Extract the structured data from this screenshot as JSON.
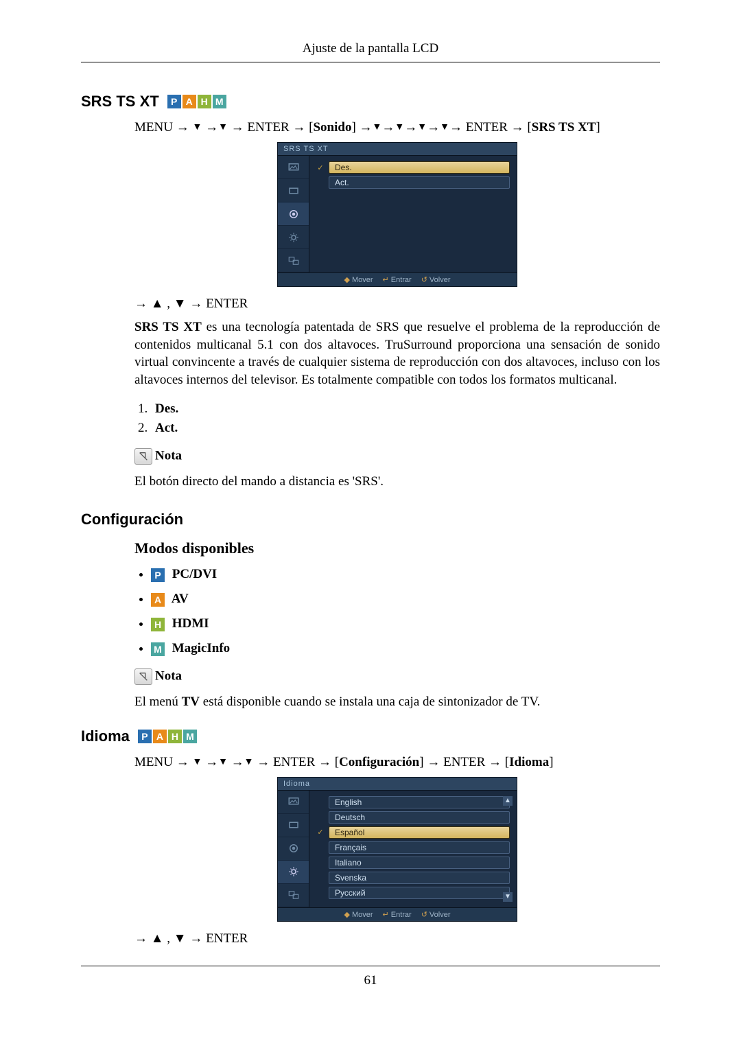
{
  "page": {
    "header": "Ajuste de la pantalla LCD",
    "number": "61"
  },
  "badges": {
    "p": "P",
    "a": "A",
    "h": "H",
    "m": "M"
  },
  "srs": {
    "title": "SRS TS XT",
    "path_pre": "MENU → ",
    "path_enter1": " → ENTER → [",
    "path_sonido": "Sonido",
    "path_mid": "] →",
    "path_enter2": "→ ENTER → [",
    "path_final": "SRS TS XT",
    "path_close": "]",
    "nav_after": "→ ▲ , ▼ → ENTER",
    "desc": "SRS TS XT es una tecnología patentada de SRS que resuelve el problema de la reproducción de contenidos multicanal 5.1 con dos altavoces. TruSurround proporciona una sensación de sonido virtual convincente a través de cualquier sistema de reproducción con dos altavoces, incluso con los altavoces internos del televisor. Es totalmente compatible con todos los formatos multicanal.",
    "opt1": "Des.",
    "opt2": "Act.",
    "nota_label": "Nota",
    "nota_text": "El botón directo del mando a distancia es 'SRS'.",
    "osd": {
      "title": "SRS TS XT",
      "row_selected": "Des.",
      "row_other": "Act.",
      "footer_move": "Mover",
      "footer_enter": "Entrar",
      "footer_back": "Volver"
    }
  },
  "config": {
    "title": "Configuración",
    "modes_title": "Modos disponibles",
    "mode_pc": "PC/DVI",
    "mode_av": "AV",
    "mode_hdmi": "HDMI",
    "mode_magic": "MagicInfo",
    "nota_label": "Nota",
    "nota_text_pre": "El menú ",
    "nota_text_bold": "TV",
    "nota_text_post": " está disponible cuando se instala una caja de sintonizador de TV."
  },
  "idioma": {
    "title": "Idioma",
    "path_pre": "MENU → ",
    "path_enter1": " → ENTER → [",
    "path_config": "Configuración",
    "path_mid": "] → ENTER → [",
    "path_final": "Idioma",
    "path_close": "]",
    "nav_after": "→ ▲ , ▼ → ENTER",
    "osd": {
      "title": "Idioma",
      "langs": [
        "English",
        "Deutsch",
        "Español",
        "Français",
        "Italiano",
        "Svenska",
        "Русский"
      ],
      "selected_index": 2,
      "footer_move": "Mover",
      "footer_enter": "Entrar",
      "footer_back": "Volver"
    }
  }
}
